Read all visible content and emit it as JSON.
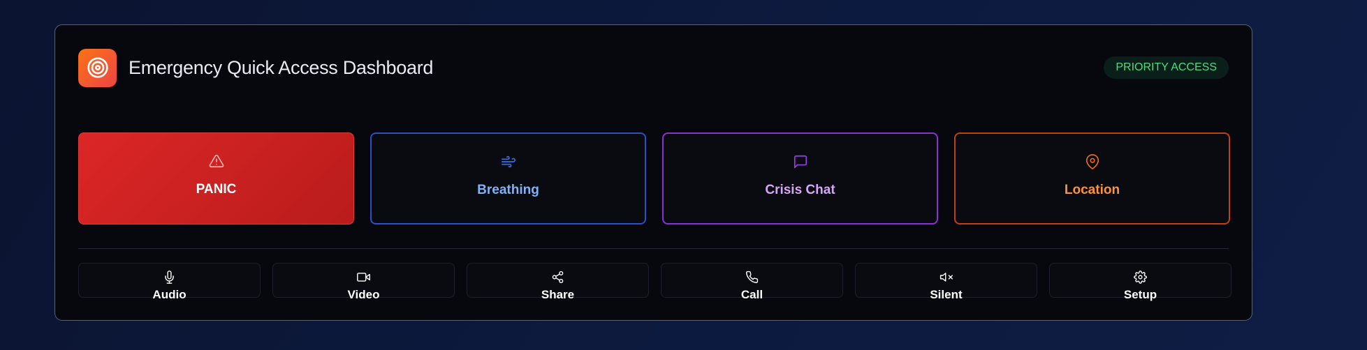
{
  "header": {
    "title": "Emergency Quick Access Dashboard",
    "badge": "PRIORITY ACCESS",
    "app_icon": "target-icon"
  },
  "primary_actions": [
    {
      "label": "PANIC",
      "icon": "alert-triangle-icon",
      "color": "#dc2626"
    },
    {
      "label": "Breathing",
      "icon": "wind-icon",
      "color": "#2f4fc9"
    },
    {
      "label": "Crisis Chat",
      "icon": "message-square-icon",
      "color": "#8b30d6"
    },
    {
      "label": "Location",
      "icon": "map-pin-icon",
      "color": "#c2410c"
    }
  ],
  "secondary_actions": [
    {
      "label": "Audio",
      "icon": "microphone-icon"
    },
    {
      "label": "Video",
      "icon": "video-camera-icon"
    },
    {
      "label": "Share",
      "icon": "share-icon"
    },
    {
      "label": "Call",
      "icon": "phone-icon"
    },
    {
      "label": "Silent",
      "icon": "volume-mute-icon"
    },
    {
      "label": "Setup",
      "icon": "gear-icon"
    }
  ],
  "colors": {
    "badge_text": "#4ade80",
    "badge_bg": "#0b1f1a",
    "app_icon_gradient_start": "#f97316",
    "app_icon_gradient_end": "#ef4444"
  }
}
